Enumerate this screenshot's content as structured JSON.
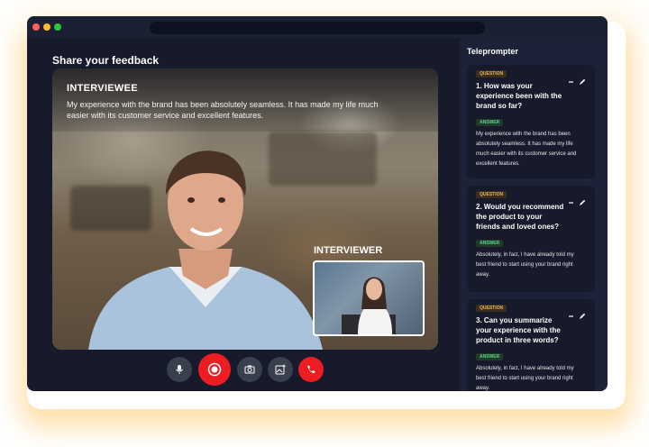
{
  "window": {
    "traffic_lights": [
      "#ff5f57",
      "#febc2e",
      "#28c840"
    ]
  },
  "main": {
    "title": "Share your feedback",
    "interviewee": {
      "label": "INTERVIEWEE",
      "text": "My experience with the brand has been absolutely seamless. It has made my life much easier with its customer service and excellent features."
    },
    "interviewer": {
      "label": "INTERVIEWER"
    }
  },
  "controls": [
    {
      "name": "microphone",
      "icon": "mic-icon"
    },
    {
      "name": "record",
      "icon": "record-icon"
    },
    {
      "name": "camera",
      "icon": "camera-icon"
    },
    {
      "name": "add-media",
      "icon": "add-image-icon"
    },
    {
      "name": "end-call",
      "icon": "phone-icon"
    }
  ],
  "teleprompter": {
    "title": "Teleprompter",
    "cards": [
      {
        "question_tag": "QUESTION",
        "question": "1. How was your experience been with the brand so far?",
        "answer_tag": "ANSWER",
        "answer": "My experience with the brand has been absolutely seamless. It has made my life much easier with its customer service and excellent features."
      },
      {
        "question_tag": "QUESTION",
        "question": "2. Would you recommend the product to your friends and loved ones?",
        "answer_tag": "ANSWER",
        "answer": "Absolutely, in fact, I have already told my best friend to start using your brand right away."
      },
      {
        "question_tag": "QUESTION",
        "question": "3. Can you summarize your experience with the product in three words?",
        "answer_tag": "ANSWER",
        "answer": "Absolutely, in fact, I have already told my best friend to start using your brand right away."
      }
    ]
  },
  "colors": {
    "accent_red": "#ee1d23",
    "panel": "#1d2238",
    "background": "#161a2b"
  }
}
